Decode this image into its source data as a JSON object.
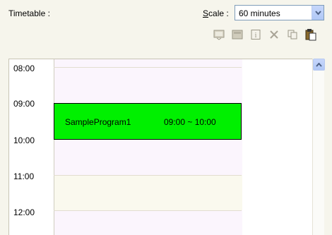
{
  "header": {
    "title": "Timetable :",
    "scale_label_prefix": "S",
    "scale_label_rest": "cale :",
    "scale_value": "60 minutes"
  },
  "toolbar": {
    "icons": [
      "schedule-icon",
      "program-icon",
      "info-icon",
      "delete-icon",
      "copy-icon",
      "paste-icon"
    ]
  },
  "timetable": {
    "hours": [
      "08:00",
      "09:00",
      "10:00",
      "11:00",
      "12:00"
    ]
  },
  "event": {
    "name": "SampleProgram1",
    "time": "09:00 ~ 10:00",
    "color": "#00f000"
  }
}
